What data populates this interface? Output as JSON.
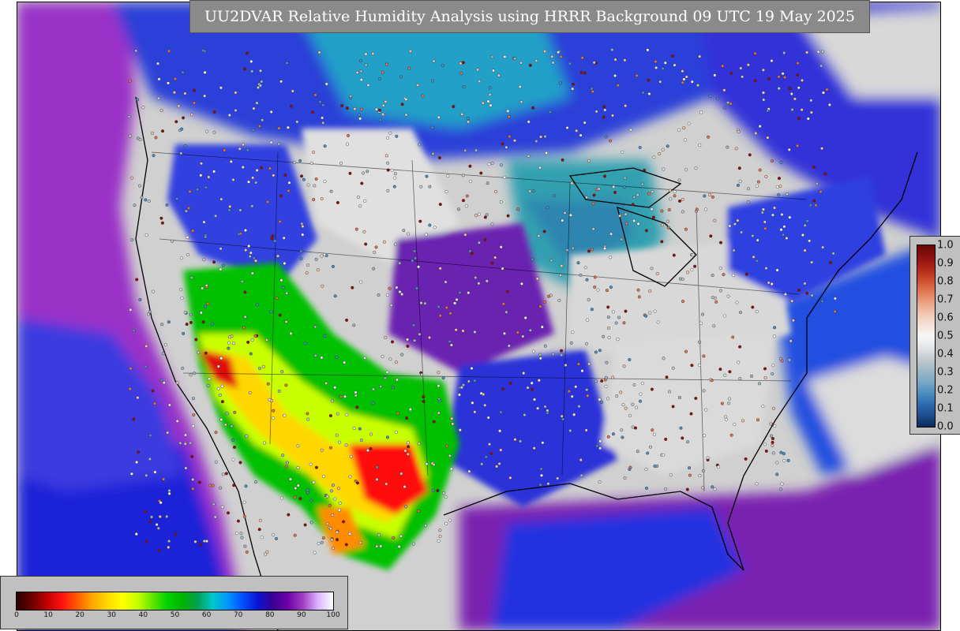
{
  "title": "UU2DVAR Relative Humidity Analysis using HRRR Background 09 UTC 19 May 2025",
  "rh_legend": {
    "ticks": [
      "0",
      "10",
      "20",
      "30",
      "40",
      "50",
      "60",
      "70",
      "80",
      "90",
      "100"
    ],
    "colors": [
      "#2a0000",
      "#6b0000",
      "#c00000",
      "#ff1010",
      "#ff5a00",
      "#ffa500",
      "#ffd700",
      "#ffff00",
      "#c8ff00",
      "#64e600",
      "#00d200",
      "#00b400",
      "#00a050",
      "#00c8c8",
      "#0096ff",
      "#0050ff",
      "#0a14d2",
      "#3c0096",
      "#6e00aa",
      "#a040c0",
      "#dcb4ff",
      "#ffffff"
    ]
  },
  "obs_legend": {
    "ticks": [
      "1.0",
      "0.9",
      "0.8",
      "0.7",
      "0.6",
      "0.5",
      "0.4",
      "0.3",
      "0.2",
      "0.1",
      "0.0"
    ],
    "colors": [
      "#0b2b5c",
      "#1d4e8f",
      "#2f6cae",
      "#4e8fbf",
      "#7aa9c7",
      "#9fb8c6",
      "#c5cbd0",
      "#e3e5e8",
      "#f7f7f7",
      "#f5e0d6",
      "#f0c6b0",
      "#eaa080",
      "#de7450",
      "#cc4a2a",
      "#b02418",
      "#8c1010",
      "#6a0808"
    ]
  },
  "map": {
    "ocean_color": "#2020e0",
    "land_color": "#d0d0d0",
    "dry_color": "#ff1010",
    "moist_color": "#00c000"
  }
}
